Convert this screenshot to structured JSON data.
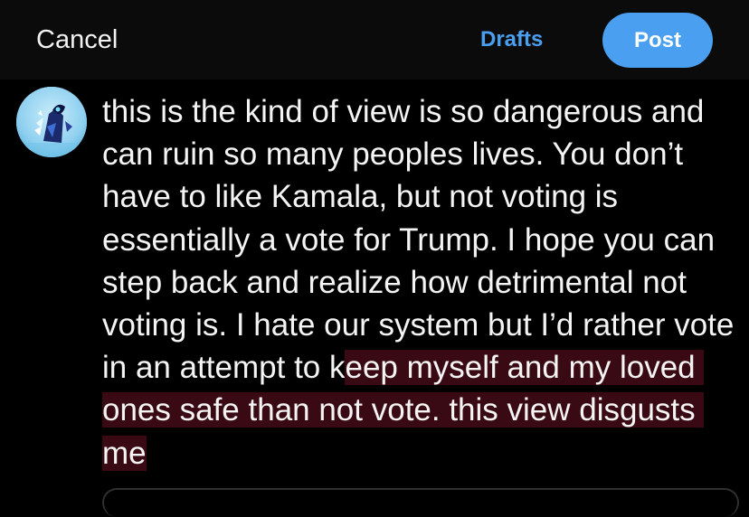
{
  "topbar": {
    "cancel_label": "Cancel",
    "drafts_label": "Drafts",
    "post_label": "Post"
  },
  "compose": {
    "text_plain": "this is the kind of view is so dangerous and can ruin so many peoples lives. You don’t have to like Kamala, but not voting is essentially a vote for Trump. I hope you can step back and realize how detrimental not voting is. I hate our system but I’d rather vote in an attempt to k",
    "text_selected": "eep myself and my loved ones safe than not vote. this view disgusts me"
  },
  "colors": {
    "accent": "#4a9ff0",
    "selection": "#3a0a14",
    "background": "#000000"
  },
  "icons": {
    "avatar": "avatar-image"
  }
}
